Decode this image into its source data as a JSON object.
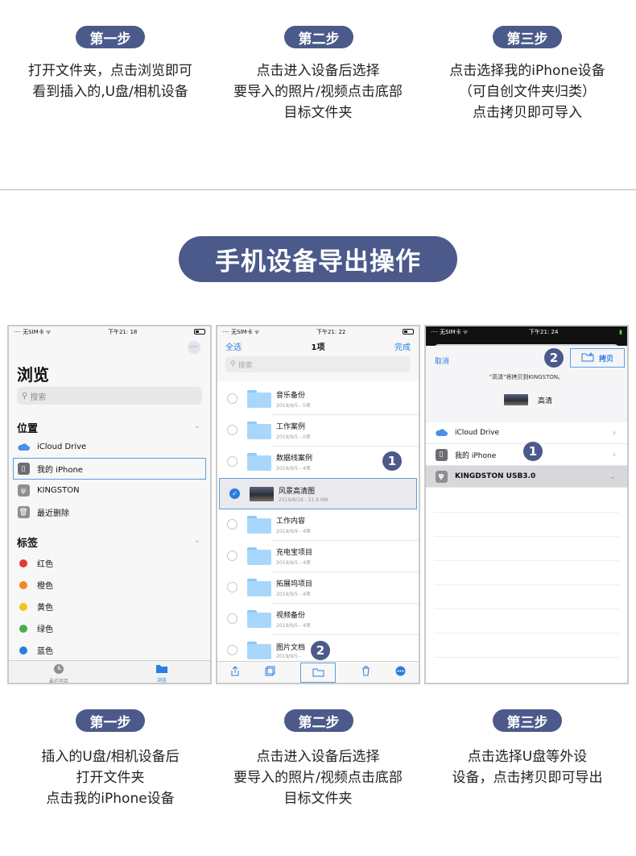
{
  "top_steps": [
    {
      "label": "第一步",
      "lines": [
        "打开文件夹，点击浏览即可",
        "看到插入的,U盘/相机设备"
      ]
    },
    {
      "label": "第二步",
      "lines": [
        "点击进入设备后选择",
        "要导入的照片/视频点击底部",
        "目标文件夹"
      ]
    },
    {
      "label": "第三步",
      "lines": [
        "点击选择我的iPhone设备",
        "（可自创文件夹归类）",
        "点击拷贝即可导入"
      ]
    }
  ],
  "section_title": "手机设备导出操作",
  "phone1": {
    "status": {
      "carrier": "无SIM卡",
      "time": "下午21: 18"
    },
    "more_icon": "···",
    "title": "浏览",
    "search_placeholder": "搜索",
    "locations_header": "位置",
    "locations": [
      "iCloud Drive",
      "我的 iPhone",
      "KINGSTON",
      "最近删除"
    ],
    "tags_header": "标签",
    "tags": [
      {
        "label": "红色",
        "color": "#e53935"
      },
      {
        "label": "橙色",
        "color": "#f08a24"
      },
      {
        "label": "黄色",
        "color": "#f5c518"
      },
      {
        "label": "绿色",
        "color": "#43b049"
      },
      {
        "label": "蓝色",
        "color": "#2a7de1"
      }
    ],
    "tabs": [
      "最近项目",
      "浏览"
    ]
  },
  "phone2": {
    "status": {
      "carrier": "无SIM卡",
      "time": "下午21: 22"
    },
    "select_all": "全选",
    "count": "1项",
    "done": "完成",
    "search_placeholder": "搜索",
    "files": [
      {
        "name": "音乐备份",
        "meta": "2019/9/5 - 5项"
      },
      {
        "name": "工作案例",
        "meta": "2019/9/5 - 0项"
      },
      {
        "name": "数据线案例",
        "meta": "2019/9/5 - 4项"
      },
      {
        "name": "风景高清图",
        "meta": "2019/8/18 - 51.9 MB",
        "selected": true
      },
      {
        "name": "工作内容",
        "meta": "2019/9/9 - 4项"
      },
      {
        "name": "充电宝项目",
        "meta": "2019/9/5 - 4项"
      },
      {
        "name": "拓展坞项目",
        "meta": "2019/9/5 - 4项"
      },
      {
        "name": "视频备份",
        "meta": "2019/9/5 - 4项"
      },
      {
        "name": "图片文档",
        "meta": "2019/9/5 -"
      }
    ],
    "badge1": "1",
    "badge2": "2"
  },
  "phone3": {
    "status": {
      "carrier": "无SIM卡",
      "time": "下午21: 24"
    },
    "cancel": "取消",
    "copy": "拷贝",
    "copy_message": "\"高清\"将拷贝到KINGSTON。",
    "item_name": "高清",
    "locations": [
      "iCloud Drive",
      "我的 iPhone",
      "KINGDSTON USB3.0"
    ],
    "badge1": "1",
    "badge2": "2"
  },
  "bottom_steps": [
    {
      "label": "第一步",
      "lines": [
        "插入的U盘/相机设备后",
        "打开文件夹",
        "点击我的iPhone设备"
      ]
    },
    {
      "label": "第二步",
      "lines": [
        "点击进入设备后选择",
        "要导入的照片/视频点击底部",
        "目标文件夹"
      ]
    },
    {
      "label": "第三步",
      "lines": [
        "点击选择U盘等外设",
        "设备，点击拷贝即可导出"
      ]
    }
  ]
}
